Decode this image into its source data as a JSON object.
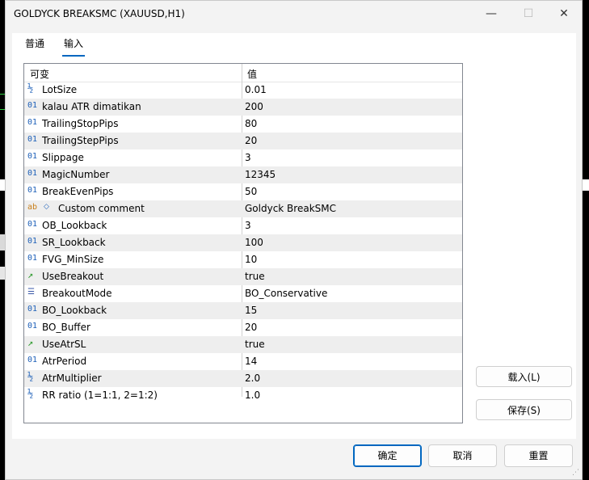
{
  "window": {
    "title": "GOLDYCK BREAKSMC (XAUUSD,H1)",
    "minimize_glyph": "—",
    "maximize_glyph": "☐",
    "close_glyph": "✕"
  },
  "tabs": [
    {
      "label": "普通"
    },
    {
      "label": "输入",
      "active": true
    }
  ],
  "table": {
    "headers": {
      "variable": "可变",
      "value": "值"
    },
    "rows": [
      {
        "icon": "½",
        "name": "LotSize",
        "value": "0.01"
      },
      {
        "icon": "01",
        "name": "kalau ATR dimatikan",
        "value": "200"
      },
      {
        "icon": "01",
        "name": "TrailingStopPips",
        "value": "80"
      },
      {
        "icon": "01",
        "name": "TrailingStepPips",
        "value": "20"
      },
      {
        "icon": "01",
        "name": "Slippage",
        "value": "3"
      },
      {
        "icon": "01",
        "name": "MagicNumber",
        "value": "12345"
      },
      {
        "icon": "01",
        "name": "BreakEvenPips",
        "value": "50"
      },
      {
        "icon": "ab",
        "bullet": "◇",
        "name": "Custom comment",
        "value": "Goldyck BreakSMC"
      },
      {
        "icon": "01",
        "name": "OB_Lookback",
        "value": "3"
      },
      {
        "icon": "01",
        "name": "SR_Lookback",
        "value": "100"
      },
      {
        "icon": "01",
        "name": "FVG_MinSize",
        "value": "10"
      },
      {
        "icon": "↗",
        "name": "UseBreakout",
        "value": "true"
      },
      {
        "icon": "☰",
        "name": "BreakoutMode",
        "value": "BO_Conservative"
      },
      {
        "icon": "01",
        "name": "BO_Lookback",
        "value": "15"
      },
      {
        "icon": "01",
        "name": "BO_Buffer",
        "value": "20"
      },
      {
        "icon": "↗",
        "name": "UseAtrSL",
        "value": "true"
      },
      {
        "icon": "01",
        "name": "AtrPeriod",
        "value": "14"
      },
      {
        "icon": "½",
        "name": "AtrMultiplier",
        "value": "2.0"
      },
      {
        "icon": "½",
        "name": "RR ratio (1=1:1, 2=1:2)",
        "value": "1.0"
      }
    ]
  },
  "side_buttons": {
    "load": "载入(L)",
    "save": "保存(S)"
  },
  "footer": {
    "ok": "确定",
    "cancel": "取消",
    "reset": "重置"
  },
  "colors": {
    "accent": "#0067c0",
    "int_icon": "#1c5fb8",
    "string_icon": "#c87d18",
    "bool_icon": "#2e9a2e"
  }
}
